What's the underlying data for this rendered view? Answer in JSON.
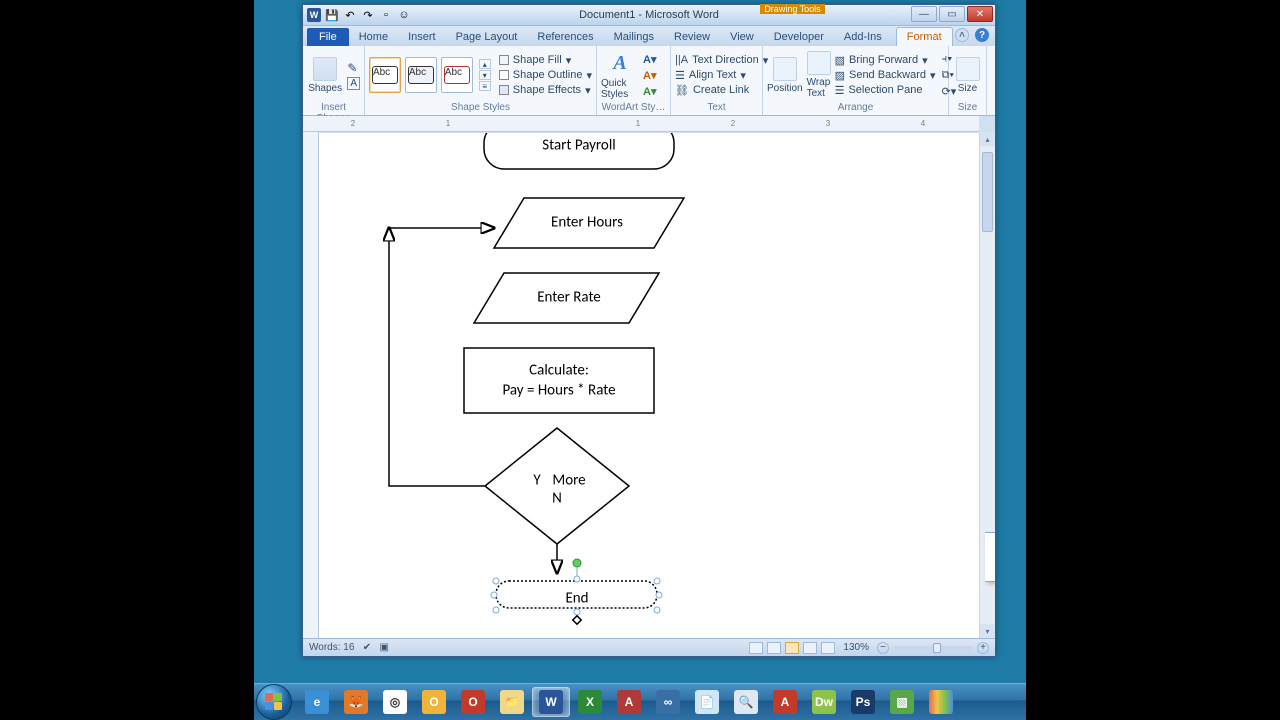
{
  "title": "Document1 - Microsoft Word",
  "contextual_tab_group": "Drawing Tools",
  "tabs": [
    "File",
    "Home",
    "Insert",
    "Page Layout",
    "References",
    "Mailings",
    "Review",
    "View",
    "Developer",
    "Add-Ins",
    "Format"
  ],
  "active_tab_index": 10,
  "ribbon": {
    "groups": {
      "insert_shapes": {
        "caption": "Insert Shapes",
        "big": "Shapes"
      },
      "shape_styles": {
        "caption": "Shape Styles",
        "preview_label": "Abc",
        "fill": "Shape Fill",
        "outline": "Shape Outline",
        "effects": "Shape Effects"
      },
      "wordart": {
        "caption": "WordArt Sty…",
        "big": "Quick Styles"
      },
      "text": {
        "caption": "Text",
        "direction": "Text Direction",
        "align": "Align Text",
        "link": "Create Link"
      },
      "arrange": {
        "caption": "Arrange",
        "position": "Position",
        "wrap": "Wrap Text",
        "fwd": "Bring Forward",
        "back": "Send Backward",
        "pane": "Selection Pane"
      },
      "size": {
        "caption": "Size",
        "big": "Size"
      }
    }
  },
  "ruler_numbers": [
    "2",
    "1",
    "1",
    "2",
    "3",
    "4"
  ],
  "flowchart": {
    "start": "Start Payroll",
    "hours": "Enter Hours",
    "rate": "Enter Rate",
    "calc1": "Calculate:",
    "calc2": "Pay = Hours * Rate",
    "decision_y": "Y",
    "decision_more": "More",
    "decision_n": "N",
    "end": "End"
  },
  "status": {
    "words_label": "Words:",
    "words": "16",
    "zoom": "130%"
  },
  "taskbar_apps": [
    {
      "name": "internet-explorer",
      "bg": "#3a8fd6",
      "txt": "e"
    },
    {
      "name": "firefox",
      "bg": "#e07a2a",
      "txt": "🦊"
    },
    {
      "name": "chrome",
      "bg": "#ffffff",
      "txt": "◎"
    },
    {
      "name": "outlook",
      "bg": "#f0b43a",
      "txt": "O"
    },
    {
      "name": "opera",
      "bg": "#c13a2a",
      "txt": "O"
    },
    {
      "name": "explorer",
      "bg": "#f0d88a",
      "txt": "📁"
    },
    {
      "name": "word",
      "bg": "#2a5599",
      "txt": "W",
      "active": true
    },
    {
      "name": "excel",
      "bg": "#2a8a3a",
      "txt": "X"
    },
    {
      "name": "access",
      "bg": "#b03a3a",
      "txt": "A"
    },
    {
      "name": "app-blue",
      "bg": "#3a6fa6",
      "txt": "∞"
    },
    {
      "name": "notepad",
      "bg": "#cfe6f5",
      "txt": "📄"
    },
    {
      "name": "magnifier",
      "bg": "#dfe8f2",
      "txt": "🔍"
    },
    {
      "name": "adobe-reader",
      "bg": "#c13a2a",
      "txt": "A"
    },
    {
      "name": "dreamweaver",
      "bg": "#8fc24a",
      "txt": "Dw"
    },
    {
      "name": "photoshop",
      "bg": "#1a3a6a",
      "txt": "Ps"
    },
    {
      "name": "app-green",
      "bg": "#5aa64a",
      "txt": "▧"
    },
    {
      "name": "app-rainbow",
      "bg": "linear-gradient(90deg,#e06b4e,#f0c44a,#7fc24a,#4a8fe0)",
      "txt": ""
    }
  ]
}
